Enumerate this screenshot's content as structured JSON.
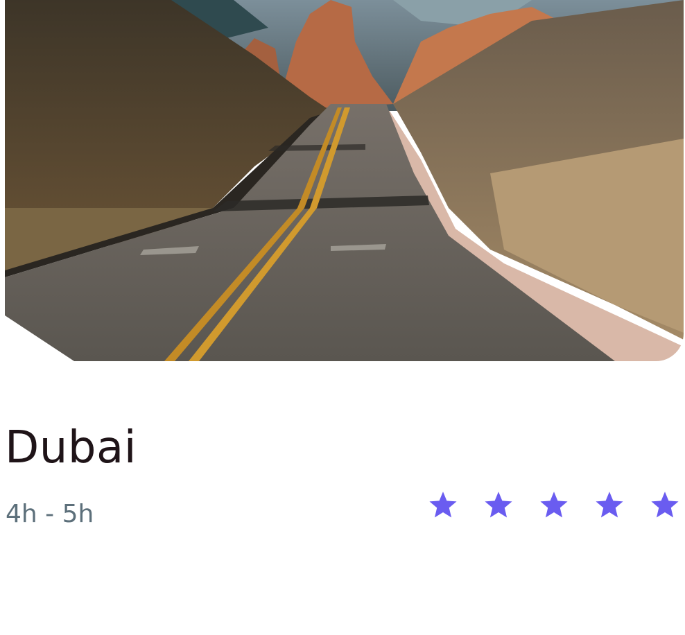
{
  "destination": {
    "name": "Dubai",
    "duration": "4h - 5h"
  },
  "photo": {
    "description_icon": "road-landscape-image"
  },
  "rating": {
    "value": 5,
    "max": 5,
    "color": "#6a5cf0"
  }
}
